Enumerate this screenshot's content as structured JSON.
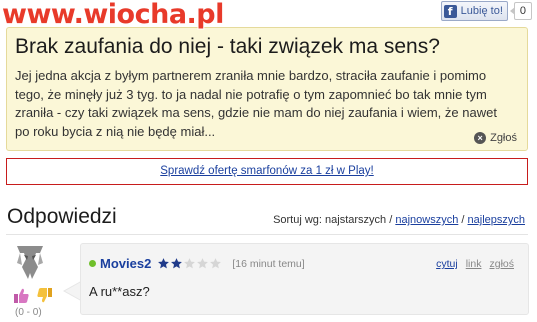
{
  "site": {
    "watermark": "www.wiocha.pl"
  },
  "facebook": {
    "like_label": "Lubię to!",
    "count": "0",
    "icon": "facebook-f-icon"
  },
  "question": {
    "title": "Brak zaufania do niej - taki związek ma sens?",
    "body": "Jej jedna akcja z byłym partnerem zraniła mnie bardzo, straciła zaufanie i pomimo tego, że minęły już 3 tyg. to ja nadal nie potrafię o tym zapomnieć bo tak mnie tym zraniła - czy taki związek ma sens, gdzie nie mam do niej zaufania i wiem, że nawet po roku bycia z nią nie będę miał...",
    "report_label": "Zgłoś"
  },
  "ad": {
    "text": "Sprawdź ofertę smarfonów za 1 zł w Play!"
  },
  "answers": {
    "heading": "Odpowiedzi",
    "sort_prefix": "Sortuj wg: najstarszych /",
    "sort_newest": "najnowszych",
    "sort_sep": "/",
    "sort_best": "najlepszych"
  },
  "answer": {
    "username": "Movies2",
    "rating_filled": 2,
    "rating_total": 5,
    "timestamp": "[16 minut temu]",
    "action_quote": "cytuj",
    "action_link": "link",
    "action_report": "zgłoś",
    "text": "A ru**asz?",
    "votes": "(0 - 0)"
  },
  "colors": {
    "accent_link": "#1a3f9e",
    "watermark": "#e83a2a",
    "question_bg": "#fbf7d7",
    "ad_border": "#c71c1c"
  }
}
